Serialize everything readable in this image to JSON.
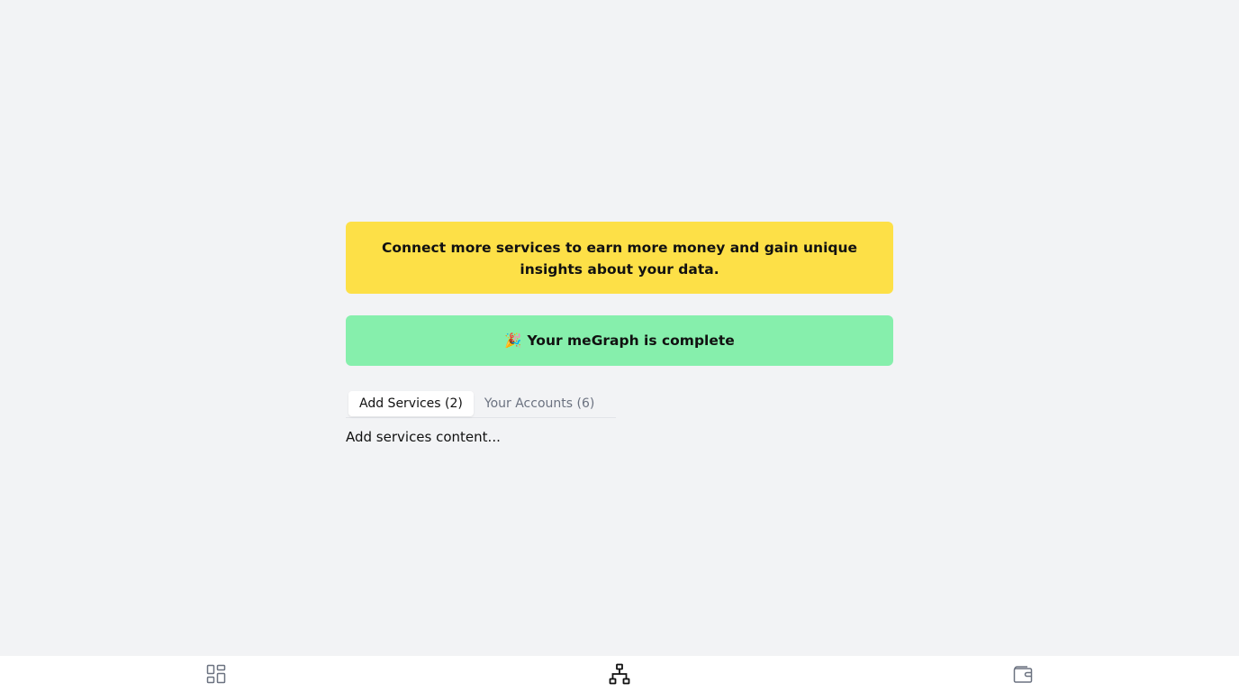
{
  "banners": {
    "connect_message": "Connect more services to earn more money and gain unique insights about your data.",
    "complete_emoji": "🎉",
    "complete_message": "Your meGraph is complete"
  },
  "tabs": [
    {
      "label": "Add Services (2)",
      "active": true
    },
    {
      "label": "Your Accounts (6)",
      "active": false
    }
  ],
  "tab_content": "Add services content...",
  "bottom_nav": [
    {
      "icon": "dashboard-grid-icon",
      "active": false
    },
    {
      "icon": "network-graph-icon",
      "active": true
    },
    {
      "icon": "wallet-icon",
      "active": false
    }
  ],
  "colors": {
    "background": "#f2f3f5",
    "yellow_banner": "#fde047",
    "green_banner": "#86efac",
    "nav_background": "#ffffff",
    "icon_inactive": "#6b7280",
    "icon_active": "#111111"
  }
}
